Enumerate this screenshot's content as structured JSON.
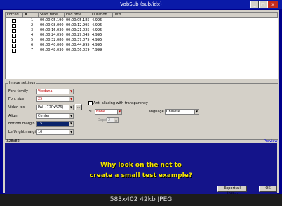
{
  "window": {
    "title": "VobSub (sub/idx)",
    "controls": [
      "_",
      "□",
      "x"
    ]
  },
  "grid": {
    "columns": [
      "Forced",
      "#",
      "Start time",
      "End time",
      "Duration",
      "Text"
    ],
    "rows": [
      {
        "num": "1",
        "start": "00:00:05.190",
        "end": "00:00:05.185",
        "dur": "4.995"
      },
      {
        "num": "2",
        "start": "00:00:08.000",
        "end": "00:00:12.995",
        "dur": "4.995"
      },
      {
        "num": "3",
        "start": "00:00:16.030",
        "end": "00:00:21.025",
        "dur": "4.995"
      },
      {
        "num": "4",
        "start": "00:00:24.050",
        "end": "00:00:29.045",
        "dur": "4.995"
      },
      {
        "num": "5",
        "start": "00:00:32.080",
        "end": "00:00:37.075",
        "dur": "4.995"
      },
      {
        "num": "6",
        "start": "00:00:40.000",
        "end": "00:00:44.995",
        "dur": "4.995"
      },
      {
        "num": "7",
        "start": "00:00:48.030",
        "end": "00:00:56.029",
        "dur": "7.999"
      }
    ]
  },
  "image_settings": {
    "label": "Image settings",
    "font_family": {
      "label": "Font family",
      "value": "Verdana"
    },
    "font_size": {
      "label": "Font size",
      "value": "25"
    },
    "video_res": {
      "label": "Video res",
      "value": "PAL (720x576)",
      "button": "..."
    },
    "align": {
      "label": "Align",
      "value": "Center"
    },
    "bottom_margin": {
      "label": "Bottom margin",
      "value": "15"
    },
    "left_right_margin": {
      "label": "Left/right margin",
      "value": "10"
    },
    "anti_alias": {
      "label": "Anti-aliasing with transparency"
    },
    "three_d": {
      "label": "3D",
      "value": "None"
    },
    "depth": {
      "label": "Depth",
      "value": "2"
    },
    "language": {
      "label": "Language",
      "value": "Chinese"
    }
  },
  "preview": {
    "size": "328x82",
    "link": "Preview",
    "line1": "Why look on the net to",
    "line2": "create a small test example?"
  },
  "buttons": {
    "export": "Export all lines...",
    "ok": "OK"
  },
  "footer": "583x402  42kb  JPEG"
}
